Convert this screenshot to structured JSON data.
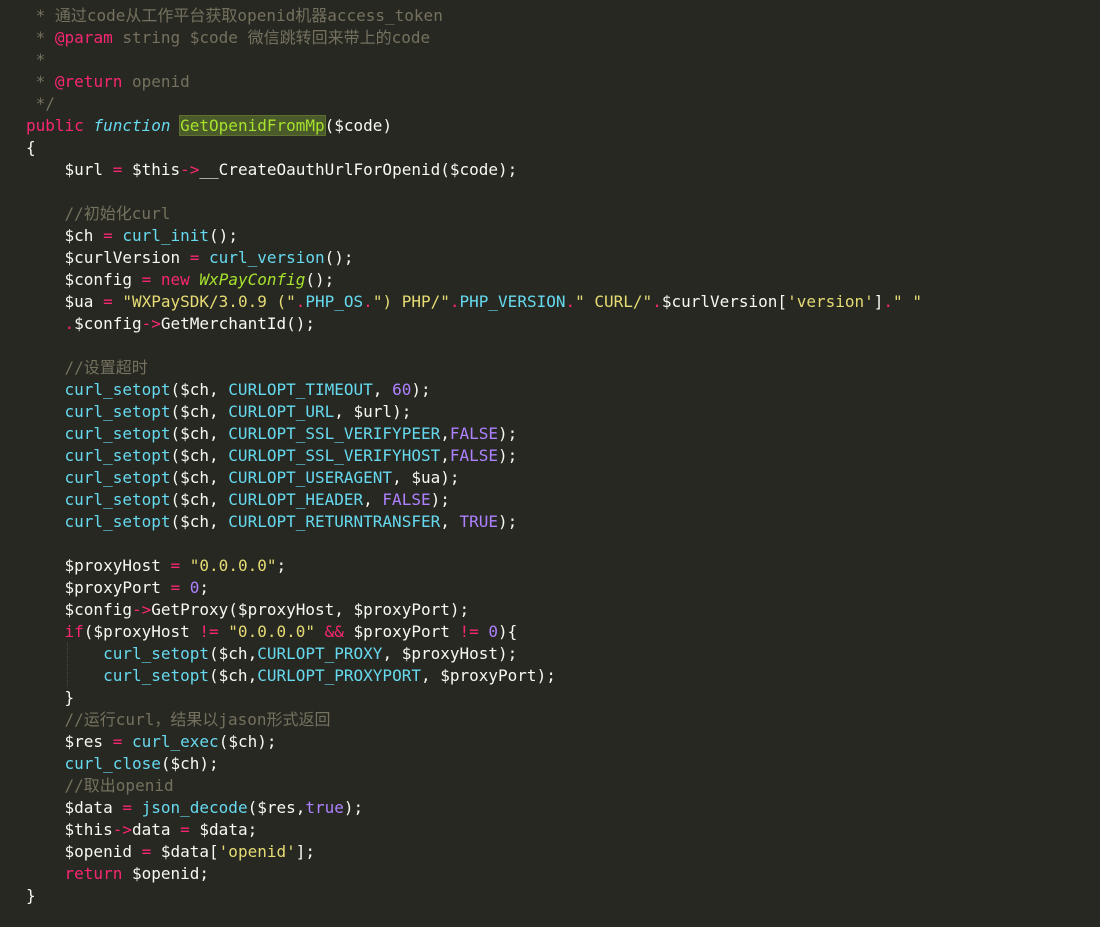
{
  "editor": {
    "background": "#272822",
    "colors": {
      "comment": "#75715e",
      "keyword": "#f92672",
      "function": "#a6e22e",
      "builtin": "#66d9ef",
      "string": "#e6db74",
      "number": "#ae81ff",
      "text": "#f8f8f2"
    },
    "lines": [
      [
        [
          "cm",
          " * 通过code从工作平台获取openid机器access_token"
        ]
      ],
      [
        [
          "cm",
          " * "
        ],
        [
          "dc",
          "@param"
        ],
        [
          "cm",
          " string $code 微信跳转回来带上的code"
        ]
      ],
      [
        [
          "cm",
          " *"
        ]
      ],
      [
        [
          "cm",
          " * "
        ],
        [
          "dc",
          "@return"
        ],
        [
          "cm",
          " openid"
        ]
      ],
      [
        [
          "cm",
          " */"
        ]
      ],
      [
        [
          "kw",
          "public"
        ],
        [
          "v",
          " "
        ],
        [
          "st",
          "function"
        ],
        [
          "v",
          " "
        ],
        [
          "fnhl",
          "GetOpenidFromMp"
        ],
        [
          "v",
          "($code)"
        ]
      ],
      [
        [
          "v",
          "{"
        ]
      ],
      [
        [
          "v",
          "    $url "
        ],
        [
          "kw",
          "="
        ],
        [
          "v",
          " $this"
        ],
        [
          "kw",
          "->"
        ],
        [
          "v",
          "__CreateOauthUrlForOpenid($code);"
        ]
      ],
      [
        [
          "v",
          ""
        ]
      ],
      [
        [
          "cm",
          "    //初始化curl"
        ]
      ],
      [
        [
          "v",
          "    $ch "
        ],
        [
          "kw",
          "="
        ],
        [
          "v",
          " "
        ],
        [
          "bi",
          "curl_init"
        ],
        [
          "v",
          "();"
        ]
      ],
      [
        [
          "v",
          "    $curlVersion "
        ],
        [
          "kw",
          "="
        ],
        [
          "v",
          " "
        ],
        [
          "bi",
          "curl_version"
        ],
        [
          "v",
          "();"
        ]
      ],
      [
        [
          "v",
          "    $config "
        ],
        [
          "kw",
          "="
        ],
        [
          "v",
          " "
        ],
        [
          "kw",
          "new"
        ],
        [
          "v",
          " "
        ],
        [
          "ty",
          "WxPayConfig"
        ],
        [
          "v",
          "();"
        ]
      ],
      [
        [
          "v",
          "    $ua "
        ],
        [
          "kw",
          "="
        ],
        [
          "v",
          " "
        ],
        [
          "s",
          "\"WXPaySDK/3.0.9 (\""
        ],
        [
          "kw",
          "."
        ],
        [
          "ct",
          "PHP_OS"
        ],
        [
          "kw",
          "."
        ],
        [
          "s",
          "\") PHP/\""
        ],
        [
          "kw",
          "."
        ],
        [
          "ct",
          "PHP_VERSION"
        ],
        [
          "kw",
          "."
        ],
        [
          "s",
          "\" CURL/\""
        ],
        [
          "kw",
          "."
        ],
        [
          "v",
          "$curlVersion["
        ],
        [
          "s",
          "'version'"
        ],
        [
          "v",
          "]"
        ],
        [
          "kw",
          "."
        ],
        [
          "s",
          "\" \""
        ]
      ],
      [
        [
          "v",
          "    "
        ],
        [
          "kw",
          "."
        ],
        [
          "v",
          "$config"
        ],
        [
          "kw",
          "->"
        ],
        [
          "v",
          "GetMerchantId();"
        ]
      ],
      [
        [
          "v",
          ""
        ]
      ],
      [
        [
          "cm",
          "    //设置超时"
        ]
      ],
      [
        [
          "v",
          "    "
        ],
        [
          "bi",
          "curl_setopt"
        ],
        [
          "v",
          "($ch, "
        ],
        [
          "ct",
          "CURLOPT_TIMEOUT"
        ],
        [
          "v",
          ", "
        ],
        [
          "n",
          "60"
        ],
        [
          "v",
          ");"
        ]
      ],
      [
        [
          "v",
          "    "
        ],
        [
          "bi",
          "curl_setopt"
        ],
        [
          "v",
          "($ch, "
        ],
        [
          "ct",
          "CURLOPT_URL"
        ],
        [
          "v",
          ", $url);"
        ]
      ],
      [
        [
          "v",
          "    "
        ],
        [
          "bi",
          "curl_setopt"
        ],
        [
          "v",
          "($ch, "
        ],
        [
          "ct",
          "CURLOPT_SSL_VERIFYPEER"
        ],
        [
          "v",
          ","
        ],
        [
          "n",
          "FALSE"
        ],
        [
          "v",
          ");"
        ]
      ],
      [
        [
          "v",
          "    "
        ],
        [
          "bi",
          "curl_setopt"
        ],
        [
          "v",
          "($ch, "
        ],
        [
          "ct",
          "CURLOPT_SSL_VERIFYHOST"
        ],
        [
          "v",
          ","
        ],
        [
          "n",
          "FALSE"
        ],
        [
          "v",
          ");"
        ]
      ],
      [
        [
          "v",
          "    "
        ],
        [
          "bi",
          "curl_setopt"
        ],
        [
          "v",
          "($ch, "
        ],
        [
          "ct",
          "CURLOPT_USERAGENT"
        ],
        [
          "v",
          ", $ua);"
        ]
      ],
      [
        [
          "v",
          "    "
        ],
        [
          "bi",
          "curl_setopt"
        ],
        [
          "v",
          "($ch, "
        ],
        [
          "ct",
          "CURLOPT_HEADER"
        ],
        [
          "v",
          ", "
        ],
        [
          "n",
          "FALSE"
        ],
        [
          "v",
          ");"
        ]
      ],
      [
        [
          "v",
          "    "
        ],
        [
          "bi",
          "curl_setopt"
        ],
        [
          "v",
          "($ch, "
        ],
        [
          "ct",
          "CURLOPT_RETURNTRANSFER"
        ],
        [
          "v",
          ", "
        ],
        [
          "n",
          "TRUE"
        ],
        [
          "v",
          ");"
        ]
      ],
      [
        [
          "v",
          ""
        ]
      ],
      [
        [
          "v",
          "    $proxyHost "
        ],
        [
          "kw",
          "="
        ],
        [
          "v",
          " "
        ],
        [
          "s",
          "\"0.0.0.0\""
        ],
        [
          "v",
          ";"
        ]
      ],
      [
        [
          "v",
          "    $proxyPort "
        ],
        [
          "kw",
          "="
        ],
        [
          "v",
          " "
        ],
        [
          "n",
          "0"
        ],
        [
          "v",
          ";"
        ]
      ],
      [
        [
          "v",
          "    $config"
        ],
        [
          "kw",
          "->"
        ],
        [
          "v",
          "GetProxy($proxyHost, $proxyPort);"
        ]
      ],
      [
        [
          "v",
          "    "
        ],
        [
          "kw",
          "if"
        ],
        [
          "v",
          "($proxyHost "
        ],
        [
          "kw",
          "!="
        ],
        [
          "v",
          " "
        ],
        [
          "s",
          "\"0.0.0.0\""
        ],
        [
          "v",
          " "
        ],
        [
          "kw",
          "&&"
        ],
        [
          "v",
          " $proxyPort "
        ],
        [
          "kw",
          "!="
        ],
        [
          "v",
          " "
        ],
        [
          "n",
          "0"
        ],
        [
          "v",
          "){"
        ]
      ],
      [
        [
          "v",
          "        "
        ],
        [
          "bi",
          "curl_setopt"
        ],
        [
          "v",
          "($ch,"
        ],
        [
          "ct",
          "CURLOPT_PROXY"
        ],
        [
          "v",
          ", $proxyHost);"
        ]
      ],
      [
        [
          "v",
          "        "
        ],
        [
          "bi",
          "curl_setopt"
        ],
        [
          "v",
          "($ch,"
        ],
        [
          "ct",
          "CURLOPT_PROXYPORT"
        ],
        [
          "v",
          ", $proxyPort);"
        ]
      ],
      [
        [
          "v",
          "    }"
        ]
      ],
      [
        [
          "cm",
          "    //运行curl，结果以jason形式返回"
        ]
      ],
      [
        [
          "v",
          "    $res "
        ],
        [
          "kw",
          "="
        ],
        [
          "v",
          " "
        ],
        [
          "bi",
          "curl_exec"
        ],
        [
          "v",
          "($ch);"
        ]
      ],
      [
        [
          "v",
          "    "
        ],
        [
          "bi",
          "curl_close"
        ],
        [
          "v",
          "($ch);"
        ]
      ],
      [
        [
          "cm",
          "    //取出openid"
        ]
      ],
      [
        [
          "v",
          "    $data "
        ],
        [
          "kw",
          "="
        ],
        [
          "v",
          " "
        ],
        [
          "bi",
          "json_decode"
        ],
        [
          "v",
          "($res,"
        ],
        [
          "n",
          "true"
        ],
        [
          "v",
          ");"
        ]
      ],
      [
        [
          "v",
          "    $this"
        ],
        [
          "kw",
          "->"
        ],
        [
          "v",
          "data "
        ],
        [
          "kw",
          "="
        ],
        [
          "v",
          " $data;"
        ]
      ],
      [
        [
          "v",
          "    $openid "
        ],
        [
          "kw",
          "="
        ],
        [
          "v",
          " $data["
        ],
        [
          "s",
          "'openid'"
        ],
        [
          "v",
          "];"
        ]
      ],
      [
        [
          "v",
          "    "
        ],
        [
          "kw",
          "return"
        ],
        [
          "v",
          " $openid;"
        ]
      ],
      [
        [
          "v",
          "}"
        ]
      ]
    ]
  }
}
